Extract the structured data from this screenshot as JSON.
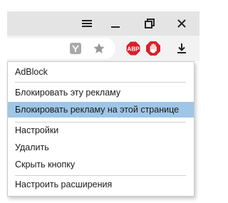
{
  "toolbar": {
    "window_buttons": [
      "hamburger-menu",
      "minimize",
      "restore",
      "close"
    ],
    "extension_icons": [
      "page-icon",
      "star-icon",
      "adblock-icon",
      "adblock-hand-icon",
      "download-icon"
    ],
    "adblock_badge_text": "ABP"
  },
  "menu": {
    "items": [
      {
        "label": "AdBlock"
      },
      {
        "label": "Блокировать эту рекламу"
      },
      {
        "label": "Блокировать рекламу на этой странице",
        "highlighted": true
      },
      {
        "label": "Настройки"
      },
      {
        "label": "Удалить"
      },
      {
        "label": "Скрыть кнопку"
      },
      {
        "label": "Настроить расширения"
      }
    ]
  },
  "colors": {
    "highlight": "#9fc6e7",
    "adblock_red": "#d8202a",
    "tabbar": "#e4e4e4"
  }
}
